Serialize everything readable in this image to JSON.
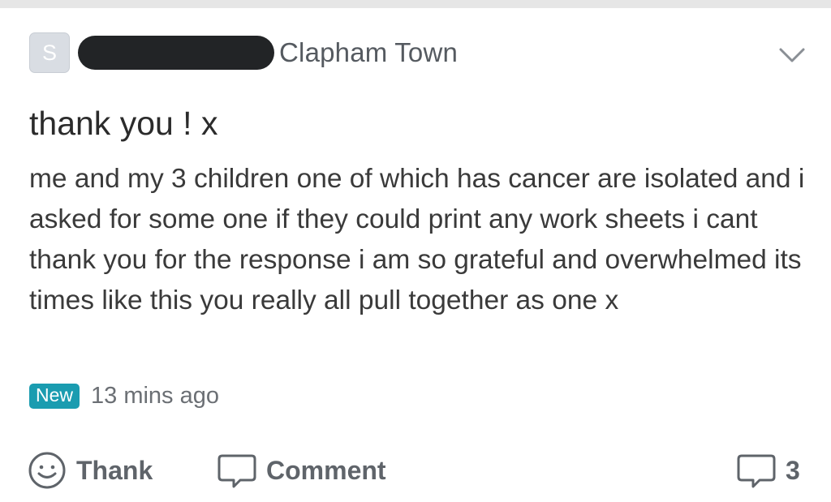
{
  "post": {
    "avatar_letter": "S",
    "neighbourhood": "Clapham Town",
    "title": "thank you ! x",
    "body": "me and my 3 children one of which has cancer are isolated and i asked for some one if they could print any work sheets i cant thank you for the response i am so grateful and overwhelmed its times like this you really all pull together as one x",
    "badge": "New",
    "timestamp": "13 mins ago"
  },
  "actions": {
    "thank_label": "Thank",
    "comment_label": "Comment",
    "comment_count": "3"
  },
  "icons": {
    "chevron": "chevron-down-icon",
    "thank": "smiley-icon",
    "comment": "speech-bubble-icon",
    "count": "speech-bubble-icon"
  },
  "colors": {
    "badge_bg": "#1a9cb0",
    "action_text": "#5f646a",
    "body_text": "#3a3a3a"
  }
}
